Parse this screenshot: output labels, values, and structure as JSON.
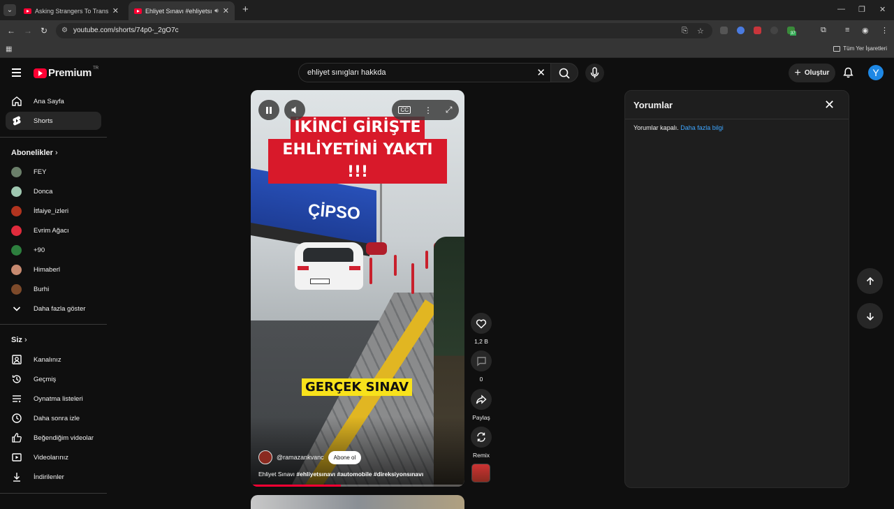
{
  "browser": {
    "tabs": [
      {
        "title": "Asking Strangers To Transform"
      },
      {
        "title": "Ehliyet Sınavı #ehliyetsınav"
      }
    ],
    "url": "youtube.com/shorts/74p0-_2gO7c",
    "bookmarks_all": "Tüm Yer İşaretleri",
    "ext_badge": "37"
  },
  "header": {
    "logo_text": "Premium",
    "logo_region": "TR",
    "search_query": "ehliyet sınıgları hakkda",
    "create_label": "Oluştur",
    "avatar_letter": "Y"
  },
  "sidebar": {
    "top_items": [
      {
        "label": "Ana Sayfa",
        "icon": "home-icon"
      },
      {
        "label": "Shorts",
        "icon": "shorts-icon"
      }
    ],
    "subscriptions_heading": "Abonelikler",
    "subscriptions": [
      {
        "label": "FEY",
        "color": "#6b7f6a"
      },
      {
        "label": "Donca",
        "color": "#9fc7b0"
      },
      {
        "label": "İtfaiye_izleri",
        "color": "#b2341f"
      },
      {
        "label": "Evrim Ağacı",
        "color": "#e02b3c"
      },
      {
        "label": "+90",
        "color": "#2d7f3e"
      },
      {
        "label": "Himaberl",
        "color": "#c78a70"
      },
      {
        "label": "Burhi",
        "color": "#7d4a2a"
      }
    ],
    "show_more": "Daha fazla göster",
    "you_heading": "Siz",
    "you_items": [
      {
        "label": "Kanalınız",
        "icon": "channel-icon"
      },
      {
        "label": "Geçmiş",
        "icon": "history-icon"
      },
      {
        "label": "Oynatma listeleri",
        "icon": "playlists-icon"
      },
      {
        "label": "Daha sonra izle",
        "icon": "watch-later-icon"
      },
      {
        "label": "Beğendiğim videolar",
        "icon": "liked-icon"
      },
      {
        "label": "Videolarınız",
        "icon": "your-videos-icon"
      },
      {
        "label": "İndirilenler",
        "icon": "downloads-icon"
      }
    ]
  },
  "video": {
    "headline_line1": "İKİNCİ GİRİŞTE",
    "headline_line2": "EHLİYETİNİ YAKTI !!!",
    "overlay_caption": "GERÇEK SINAV",
    "truck_brand": "ÇİPSO",
    "channel": "@ramazankvanc",
    "subscribe_label": "Abone ol",
    "title_plain": "Ehliyet Sınavı",
    "title_tags": "#ehliyetsınavı #automobile #direksiyonsınavı",
    "progress": 0.42
  },
  "actions": {
    "likes": "1,2 B",
    "comments_count": "0",
    "share_label": "Paylaş",
    "remix_label": "Remix"
  },
  "comments_panel": {
    "title": "Yorumlar",
    "disabled_text": "Yorumlar kapalı.",
    "learn_more": "Daha fazla bilgi"
  }
}
